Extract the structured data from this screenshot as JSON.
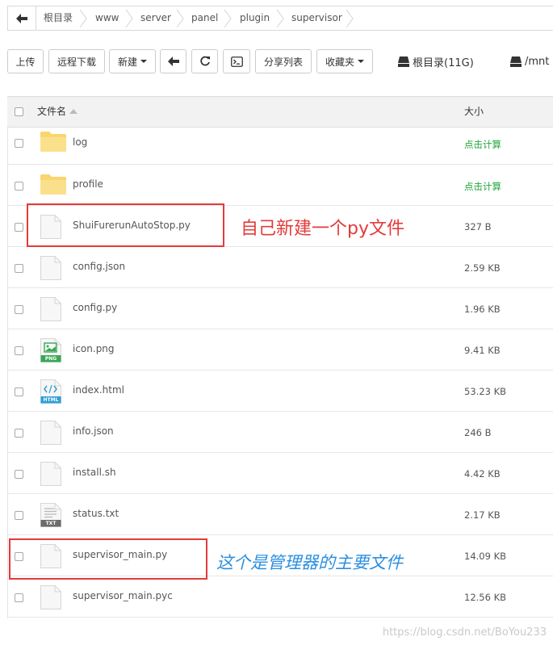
{
  "breadcrumb": [
    "根目录",
    "www",
    "server",
    "panel",
    "plugin",
    "supervisor"
  ],
  "toolbar": {
    "upload": "上传",
    "remote_download": "远程下载",
    "new": "新建",
    "share_list": "分享列表",
    "favorites": "收藏夹"
  },
  "disks": [
    {
      "label": "根目录(11G)",
      "icon": "hard-drive-icon"
    },
    {
      "label": "/mnt",
      "icon": "hard-drive-icon"
    }
  ],
  "table": {
    "col_name": "文件名",
    "col_size": "大小",
    "rows": [
      {
        "name": "log",
        "size": "点击计算",
        "type": "folder"
      },
      {
        "name": "profile",
        "size": "点击计算",
        "type": "folder"
      },
      {
        "name": "ShuiFurerunAutoStop.py",
        "size": "327 B",
        "type": "file"
      },
      {
        "name": "config.json",
        "size": "2.59 KB",
        "type": "file"
      },
      {
        "name": "config.py",
        "size": "1.96 KB",
        "type": "file"
      },
      {
        "name": "icon.png",
        "size": "9.41 KB",
        "type": "png"
      },
      {
        "name": "index.html",
        "size": "53.23 KB",
        "type": "html"
      },
      {
        "name": "info.json",
        "size": "246 B",
        "type": "file"
      },
      {
        "name": "install.sh",
        "size": "4.42 KB",
        "type": "file"
      },
      {
        "name": "status.txt",
        "size": "2.17 KB",
        "type": "txt"
      },
      {
        "name": "supervisor_main.py",
        "size": "14.09 KB",
        "type": "file"
      },
      {
        "name": "supervisor_main.pyc",
        "size": "12.56 KB",
        "type": "file"
      }
    ]
  },
  "file_badges": {
    "png": "PNG",
    "html": "HTML",
    "txt": "TXT"
  },
  "annotations": {
    "new_file": "自己新建一个py文件",
    "main_file": "这个是管理器的主要文件"
  },
  "colors": {
    "annotation_red": "#e53a3a",
    "annotation_blue": "#2b8fe0",
    "calc_green": "#20a53a"
  },
  "watermark": "https://blog.csdn.net/BoYou233"
}
